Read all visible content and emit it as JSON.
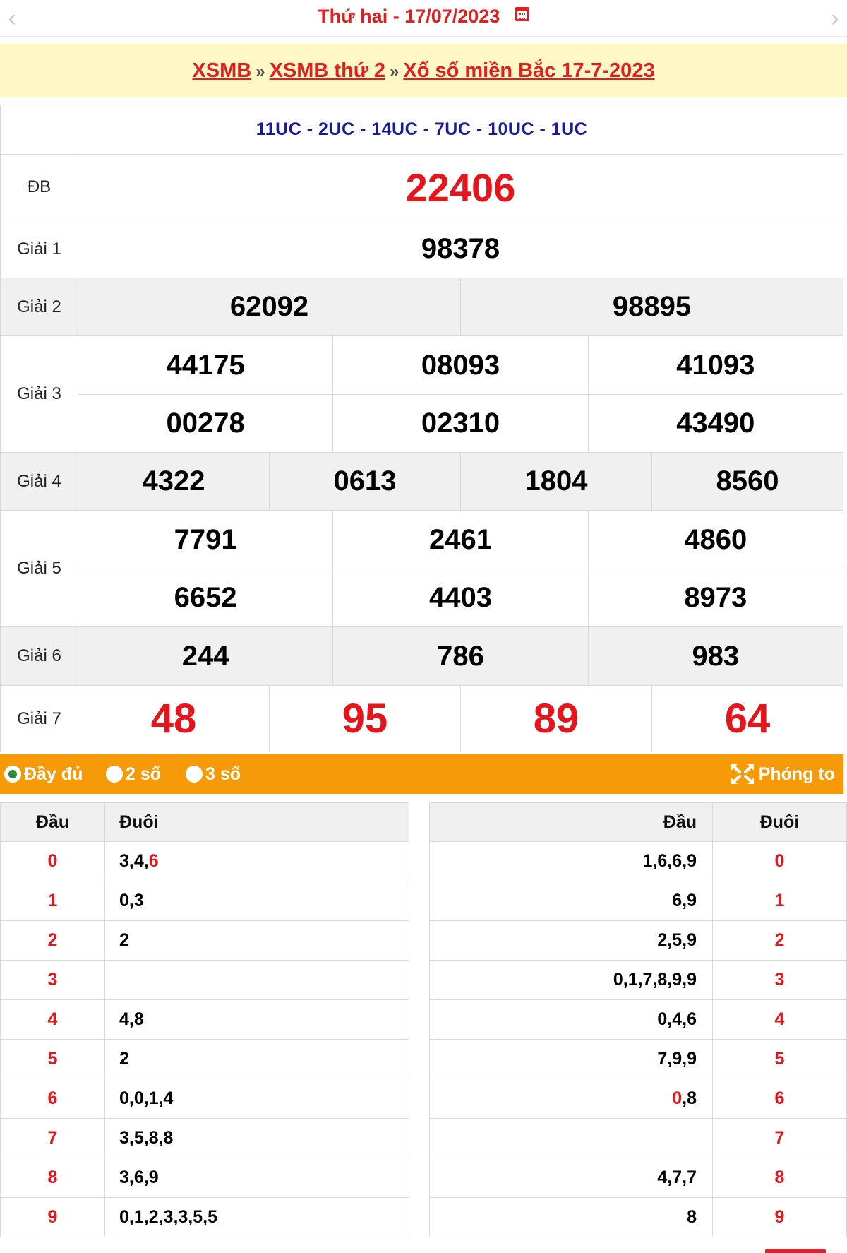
{
  "header": {
    "prev_icon": "chevron-left-icon",
    "next_icon": "chevron-right-icon",
    "weekday": "Thứ hai -",
    "date": "17/07/2023",
    "calendar_icon": "calendar-icon"
  },
  "breadcrumb": {
    "items": [
      "XSMB",
      "XSMB thứ 2",
      "Xổ số miền Bắc 17-7-2023"
    ],
    "separator": "»"
  },
  "results": {
    "codes": "11UC - 2UC - 14UC - 7UC - 10UC - 1UC",
    "db": {
      "label": "ĐB",
      "values": [
        "22406"
      ]
    },
    "g1": {
      "label": "Giải 1",
      "values": [
        "98378"
      ]
    },
    "g2": {
      "label": "Giải 2",
      "values": [
        "62092",
        "98895"
      ]
    },
    "g3": {
      "label": "Giải 3",
      "values": [
        "44175",
        "08093",
        "41093",
        "00278",
        "02310",
        "43490"
      ]
    },
    "g4": {
      "label": "Giải 4",
      "values": [
        "4322",
        "0613",
        "1804",
        "8560"
      ]
    },
    "g5": {
      "label": "Giải 5",
      "values": [
        "7791",
        "2461",
        "4860",
        "6652",
        "4403",
        "8973"
      ]
    },
    "g6": {
      "label": "Giải 6",
      "values": [
        "244",
        "786",
        "983"
      ]
    },
    "g7": {
      "label": "Giải 7",
      "values": [
        "48",
        "95",
        "89",
        "64"
      ]
    }
  },
  "options": {
    "full": "Đầy đủ",
    "two": "2 số",
    "three": "3 số",
    "selected": "full",
    "zoom": "Phóng to",
    "zoom_icon": "expand-icon"
  },
  "dau_table": {
    "head": "Đầu",
    "tail": "Đuôi",
    "rows": [
      {
        "dau": "0",
        "duoi": "3,4,",
        "duoi_hl": "6"
      },
      {
        "dau": "1",
        "duoi": "0,3",
        "duoi_hl": ""
      },
      {
        "dau": "2",
        "duoi": "2",
        "duoi_hl": ""
      },
      {
        "dau": "3",
        "duoi": "",
        "duoi_hl": ""
      },
      {
        "dau": "4",
        "duoi": "4,8",
        "duoi_hl": ""
      },
      {
        "dau": "5",
        "duoi": "2",
        "duoi_hl": ""
      },
      {
        "dau": "6",
        "duoi": "0,0,1,4",
        "duoi_hl": ""
      },
      {
        "dau": "7",
        "duoi": "3,5,8,8",
        "duoi_hl": ""
      },
      {
        "dau": "8",
        "duoi": "3,6,9",
        "duoi_hl": ""
      },
      {
        "dau": "9",
        "duoi": "0,1,2,3,3,5,5",
        "duoi_hl": ""
      }
    ]
  },
  "duoi_table": {
    "head": "Đầu",
    "tail": "Đuôi",
    "rows": [
      {
        "dau_hl": "",
        "dau": "1,6,6,9",
        "duoi": "0"
      },
      {
        "dau_hl": "",
        "dau": "6,9",
        "duoi": "1"
      },
      {
        "dau_hl": "",
        "dau": "2,5,9",
        "duoi": "2"
      },
      {
        "dau_hl": "",
        "dau": "0,1,7,8,9,9",
        "duoi": "3"
      },
      {
        "dau_hl": "",
        "dau": "0,4,6",
        "duoi": "4"
      },
      {
        "dau_hl": "",
        "dau": "7,9,9",
        "duoi": "5"
      },
      {
        "dau_hl": "0",
        "dau": ",8",
        "duoi": "6"
      },
      {
        "dau_hl": "",
        "dau": "",
        "duoi": "7"
      },
      {
        "dau_hl": "",
        "dau": "4,7,7",
        "duoi": "8"
      },
      {
        "dau_hl": "",
        "dau": "8",
        "duoi": "9"
      }
    ]
  },
  "colors": {
    "accent_red": "#e8141b",
    "code_blue": "#1a1a9e",
    "breadcrumb_bg": "#fff7c5",
    "options_bar": "#f79a0a"
  }
}
